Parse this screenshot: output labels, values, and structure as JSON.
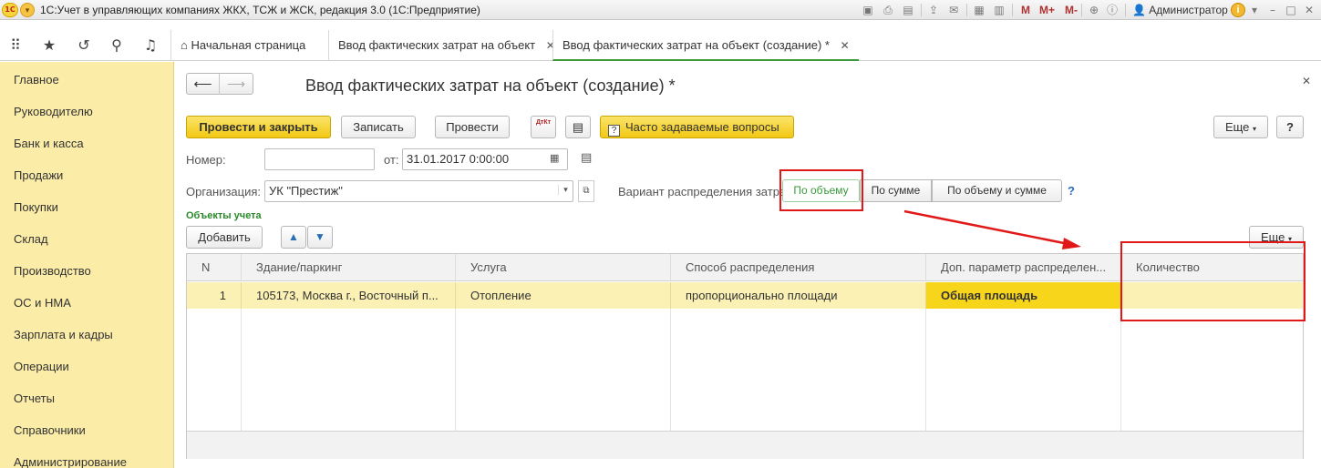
{
  "titlebar": {
    "logo": "1С",
    "title": "1С:Учет в управляющих компаниях ЖКХ, ТСЖ и ЖСК, редакция 3.0  (1С:Предприятие)",
    "m_buttons": [
      "M",
      "M+",
      "M-"
    ],
    "user": "Администратор",
    "info": "i"
  },
  "tabs": {
    "home": "Начальная страница",
    "tab1": "Ввод фактических затрат на объект",
    "tab2": "Ввод фактических затрат на объект (создание) *",
    "close": "✕"
  },
  "sidebar": {
    "items": [
      "Главное",
      "Руководителю",
      "Банк и касса",
      "Продажи",
      "Покупки",
      "Склад",
      "Производство",
      "ОС и НМА",
      "Зарплата и кадры",
      "Операции",
      "Отчеты",
      "Справочники",
      "Администрирование"
    ]
  },
  "form": {
    "title": "Ввод фактических затрат на объект (создание) *",
    "post_and_close": "Провести и закрыть",
    "save": "Записать",
    "post": "Провести",
    "dt_kt": "ДтКт",
    "faq": "Часто задаваемые вопросы",
    "more": "Еще",
    "help": "?",
    "number_label": "Номер:",
    "number_value": "",
    "date_label": "от:",
    "date_value": "31.01.2017  0:00:00",
    "org_label": "Организация:",
    "org_value": "УК \"Престиж\"",
    "variant_label": "Вариант распределения затрат:",
    "variant_options": [
      "По объему",
      "По сумме",
      "По объему и сумме"
    ],
    "variant_selected": "По объему",
    "variant_help": "?",
    "section_title": "Объекты учета",
    "add": "Добавить",
    "grid_more": "Еще"
  },
  "grid": {
    "columns": [
      "N",
      "Здание/паркинг",
      "Услуга",
      "Способ распределения",
      "Доп. параметр распределен...",
      "Количество"
    ],
    "rows": [
      [
        "1",
        "105173, Москва г., Восточный п...",
        "Отопление",
        "пропорционально площади",
        "Общая площадь",
        ""
      ]
    ]
  },
  "colors": {
    "accent_yellow": "#f2c914",
    "sidebar_bg": "#fbeca8",
    "annotation_red": "#e01818",
    "selected_green": "#3a9a3a"
  }
}
